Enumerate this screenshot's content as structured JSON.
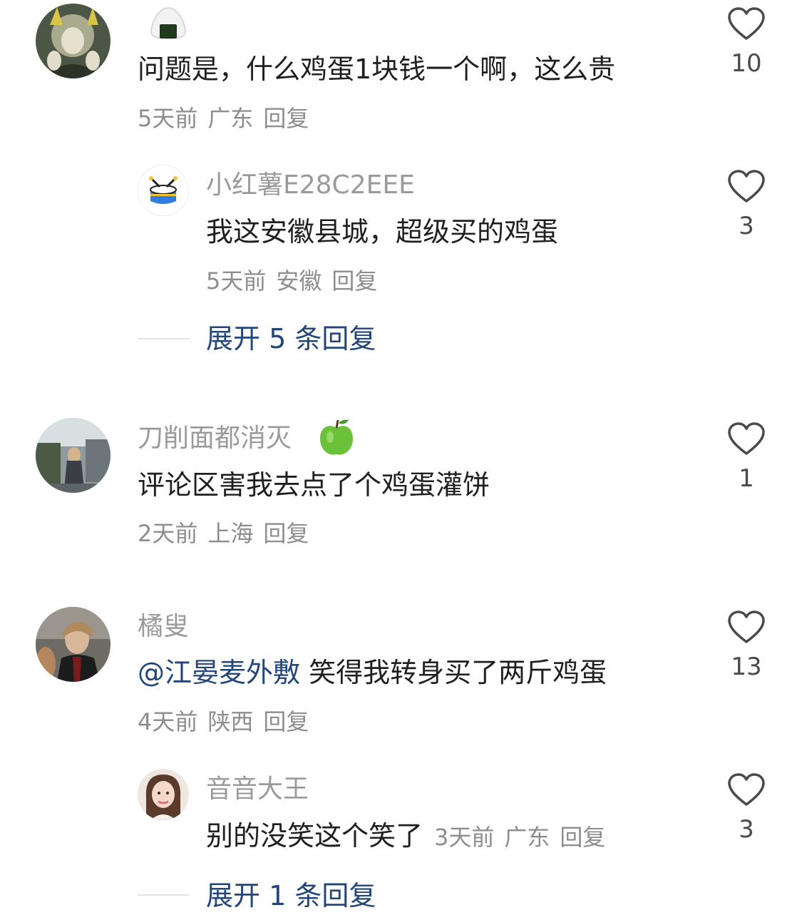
{
  "comments": [
    {
      "name": "",
      "emoji_icon": "rice-ball-icon",
      "content": "问题是，什么鸡蛋1块钱一个啊，这么贵",
      "time": "5天前",
      "location": "广东",
      "reply_label": "回复",
      "likes": "10"
    },
    {
      "name": "小红薯E28C2EEE",
      "content": "我这安徽县城，超级买的鸡蛋",
      "time": "5天前",
      "location": "安徽",
      "reply_label": "回复",
      "likes": "3",
      "expand_label": "展开 5 条回复"
    },
    {
      "name": "刀削面都消灭",
      "name_emoji": "green-apple-icon",
      "content": "评论区害我去点了个鸡蛋灌饼",
      "time": "2天前",
      "location": "上海",
      "reply_label": "回复",
      "likes": "1"
    },
    {
      "name": "橘叟",
      "mention": "@江晏麦外敷",
      "content": " 笑得我转身买了两斤鸡蛋",
      "time": "4天前",
      "location": "陕西",
      "reply_label": "回复",
      "likes": "13"
    },
    {
      "name": "音音大王",
      "content": "别的没笑这个笑了",
      "time": "3天前",
      "location": "广东",
      "reply_label": "回复",
      "likes": "3",
      "expand_label": "展开 1 条回复"
    }
  ],
  "colors": {
    "link": "#22457a",
    "meta": "#8d8d8d",
    "name": "#9a9a9a"
  }
}
